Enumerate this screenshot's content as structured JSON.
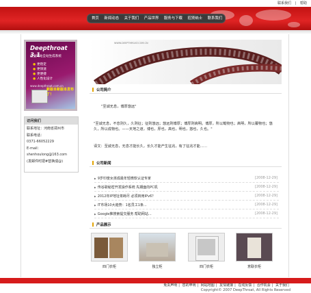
{
  "top_links": {
    "contact": "联系我们",
    "help": "帮助"
  },
  "nav": [
    "首页",
    "新闻动态",
    "关于我们",
    "产品世界",
    "服务与下载",
    "招贤纳士",
    "联系我们"
  ],
  "banner": {
    "site_text": "WWW.DEEPTHROAT.COM.CN"
  },
  "promo": {
    "title": "Deepthroat 3.1",
    "subtitle": "企业网站全站生成系统",
    "features": [
      "更稳定",
      "更快速",
      "更便捷",
      "人性化设计"
    ],
    "url": "www.deepthroat.com.cn",
    "button": "新版本新版本发布了！"
  },
  "contact": {
    "header": "访问我们",
    "address": "联系地址：河南省郑州市",
    "phone_label": "联系电话：",
    "phone": "0371-66052229",
    "email_label": "E-mail：",
    "email": "shenhoulong@163.com",
    "note": "(发邮件时把#替换成@)"
  },
  "sections": {
    "about": "公司简介",
    "news": "公司新闻",
    "products": "产品展示"
  },
  "about": {
    "quote": "\"至诚无息，博厚悠远\"",
    "p1": "\"至诚无息，不息则久，久则征；征则悠远；悠远则博厚；博厚则高明。博厚，所以载物也；高明，所以覆物也；悠久，所以成物也。——天地之道，博也，厚也，高也，明也，悠也，久也。\"",
    "p2": "译文：至诚无息，无息才能长久，长久才能产生征兆，有了征兆才能……"
  },
  "news": [
    {
      "title": "9岁印度女孩成最年轻微软认证专家",
      "date": "[2008-12-29]"
    },
    {
      "title": "传谷歌秘密开发操作系统 先期面向PC机",
      "date": "[2008-12-29]"
    },
    {
      "title": "2012年IP地址将耗尽 必须转用IPv6？",
      "date": "[2008-12-29]"
    },
    {
      "title": "IT市场10大趋势：1名员工1条...",
      "date": "[2008-12-29]"
    },
    {
      "title": "Google推搜索提交服务 帮助网站...",
      "date": "[2008-12-29]"
    }
  ],
  "products": [
    "四门衣柜",
    "独立柜",
    "四门衣柜",
    "意联衣柜"
  ],
  "footer": {
    "links": [
      "免责声明",
      "您的申明",
      "网站地图",
      "友情链接",
      "在线反馈",
      "合作机会",
      "关于我们"
    ],
    "copyright": "Copyright© 2007 DeepThroat, All Rights Reserved"
  },
  "colors": {
    "brand_red": "#d61b1b",
    "nav_bg": "#3b3b3b",
    "accent": "#e2a400"
  }
}
